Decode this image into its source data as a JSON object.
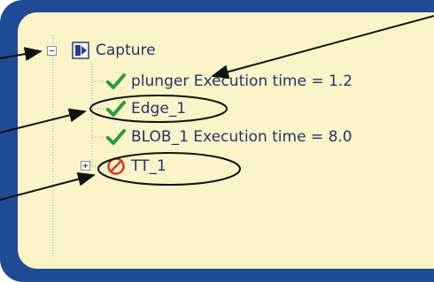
{
  "tree": {
    "root": {
      "label": "Capture",
      "expanded": true,
      "icon": "capture-icon"
    },
    "children": [
      {
        "label": "plunger Execution time = 1.2",
        "status": "pass",
        "icon": "checkmark-icon"
      },
      {
        "label": "Edge_1",
        "status": "pass",
        "icon": "checkmark-icon"
      },
      {
        "label": "BLOB_1 Execution time = 8.0",
        "status": "pass",
        "icon": "checkmark-icon"
      },
      {
        "label": "TT_1",
        "status": "disabled",
        "icon": "prohibited-icon",
        "expanded": false
      }
    ]
  },
  "colors": {
    "frame": "#1f4b95",
    "panel": "#fbf4c8",
    "text": "#28306a",
    "check": "#2e9a3a",
    "prohibited": "#d23a2a"
  }
}
